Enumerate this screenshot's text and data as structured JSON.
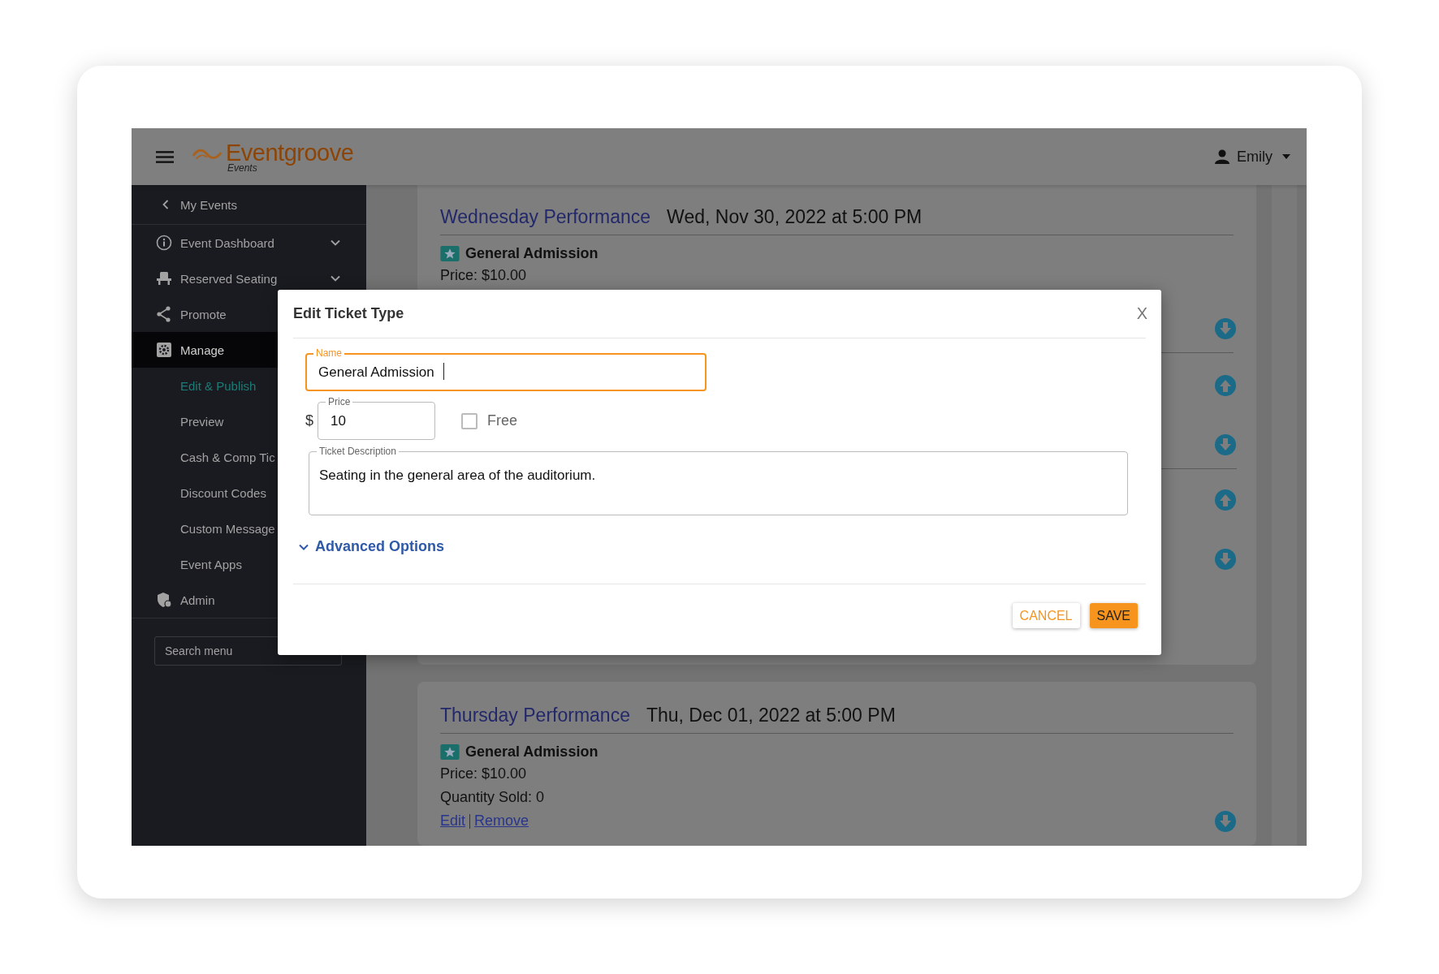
{
  "header": {
    "logo": "Eventgroove",
    "logo_sub": "Events",
    "user": "Emily"
  },
  "sidebar": {
    "back": "My Events",
    "items": [
      {
        "label": "Event Dashboard",
        "kind": "dropdown",
        "selected": false
      },
      {
        "label": "Reserved Seating",
        "kind": "dropdown",
        "selected": false
      },
      {
        "label": "Promote",
        "kind": "link",
        "selected": false
      },
      {
        "label": "Manage",
        "kind": "group",
        "selected": true,
        "children": [
          {
            "label": "Edit & Publish",
            "selected": true
          },
          {
            "label": "Preview",
            "selected": false
          },
          {
            "label": "Cash & Comp Tic",
            "selected": false
          },
          {
            "label": "Discount Codes",
            "selected": false
          },
          {
            "label": "Custom Message",
            "selected": false
          },
          {
            "label": "Event Apps",
            "selected": false
          }
        ]
      },
      {
        "label": "Admin",
        "kind": "link",
        "selected": false
      }
    ],
    "search": {
      "placeholder": "Search menu"
    }
  },
  "events": [
    {
      "title": "Wednesday Performance",
      "date": "Wed, Nov 30, 2022 at 5:00 PM",
      "tickets": [
        {
          "name": "General Admission",
          "lines": [
            "Price: $10.00"
          ]
        }
      ]
    },
    {
      "title": "Thursday Performance",
      "date": "Thu, Dec 01, 2022 at 5:00 PM",
      "tickets": [
        {
          "name": "General Admission",
          "lines": [
            "Price: $10.00",
            "Quantity Sold: 0"
          ],
          "links": [
            "Edit",
            "Remove"
          ]
        }
      ]
    }
  ],
  "modal": {
    "title": "Edit Ticket Type",
    "close": "X",
    "name": {
      "label": "Name",
      "value": "General Admission",
      "focused": true
    },
    "price": {
      "currency": "$",
      "label": "Price",
      "value": "10"
    },
    "free": {
      "label": "Free",
      "checked": false
    },
    "description": {
      "label": "Ticket Description",
      "value": "Seating in the general area of the auditorium."
    },
    "advanced": {
      "label": "Advanced Options"
    },
    "buttons": [
      {
        "label": "CANCEL",
        "kind": "secondary"
      },
      {
        "label": "SAVE",
        "kind": "primary"
      }
    ]
  }
}
